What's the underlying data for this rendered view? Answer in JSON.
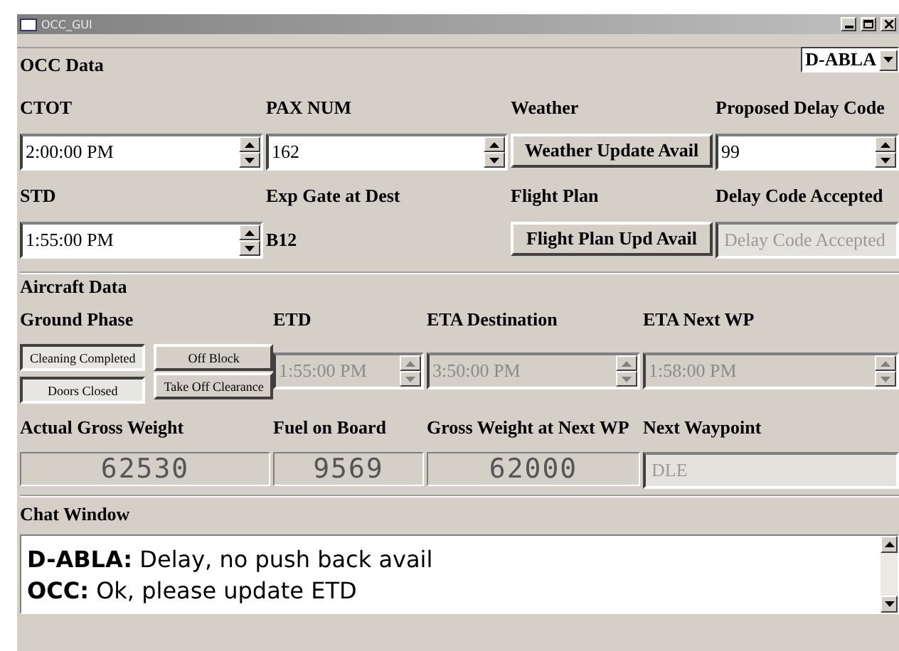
{
  "window": {
    "title": "OCC_GUI"
  },
  "occ_data": {
    "title": "OCC Data",
    "aircraft_select": "D-ABLA",
    "rows": [
      [
        {
          "label": "CTOT",
          "kind": "spinbox",
          "value": "2:00:00 PM"
        },
        {
          "label": "PAX NUM",
          "kind": "spinbox",
          "value": "162"
        },
        {
          "label": "Weather",
          "kind": "button",
          "value": "Weather Update Avail"
        },
        {
          "label": "Proposed Delay Code",
          "kind": "spinbox",
          "value": "99"
        }
      ],
      [
        {
          "label": "STD",
          "kind": "spinbox",
          "value": "1:55:00 PM"
        },
        {
          "label": "Exp Gate at Dest",
          "kind": "text",
          "value": "B12"
        },
        {
          "label": "Flight Plan",
          "kind": "button",
          "value": "Flight Plan Upd Avail"
        },
        {
          "label": "Delay Code Accepted",
          "kind": "field",
          "value": "Delay Code Accepted"
        }
      ]
    ]
  },
  "aircraft_data": {
    "title": "Aircraft Data",
    "ground_phase": {
      "label": "Ground Phase",
      "toggles": [
        {
          "label": "Cleaning Completed",
          "pressed": true
        },
        {
          "label": "Off Block",
          "pressed": false
        },
        {
          "label": "Doors Closed",
          "pressed": true
        },
        {
          "label": "Take Off Clearance",
          "pressed": false
        }
      ]
    },
    "times": [
      {
        "label": "ETD",
        "value": "1:55:00 PM",
        "disabled": true
      },
      {
        "label": "ETA Destination",
        "value": "3:50:00 PM",
        "disabled": true
      },
      {
        "label": "ETA Next WP",
        "value": "1:58:00 PM",
        "disabled": true
      }
    ],
    "readouts": [
      {
        "label": "Actual Gross Weight",
        "kind": "lcd",
        "value": "62530"
      },
      {
        "label": "Fuel on Board",
        "kind": "lcd",
        "value": "9569"
      },
      {
        "label": "Gross Weight at Next WP",
        "kind": "lcd",
        "value": "62000"
      },
      {
        "label": "Next Waypoint",
        "kind": "field",
        "value": "DLE"
      }
    ]
  },
  "chat": {
    "title": "Chat Window",
    "messages": [
      "**D-ABLA:** Delay, no push back avail",
      "**OCC:** Ok, please update ETD"
    ]
  }
}
